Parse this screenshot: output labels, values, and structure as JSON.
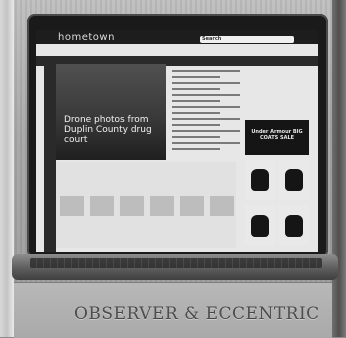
{
  "screen": {
    "brand": "hometown",
    "search_label": "Search",
    "hero_title": "Drone photos from Duplin County drug court"
  },
  "ad": {
    "text": "Under Armour BIG COATS SALE"
  },
  "sign": {
    "text": "OBSERVER & ECCENTRIC"
  }
}
